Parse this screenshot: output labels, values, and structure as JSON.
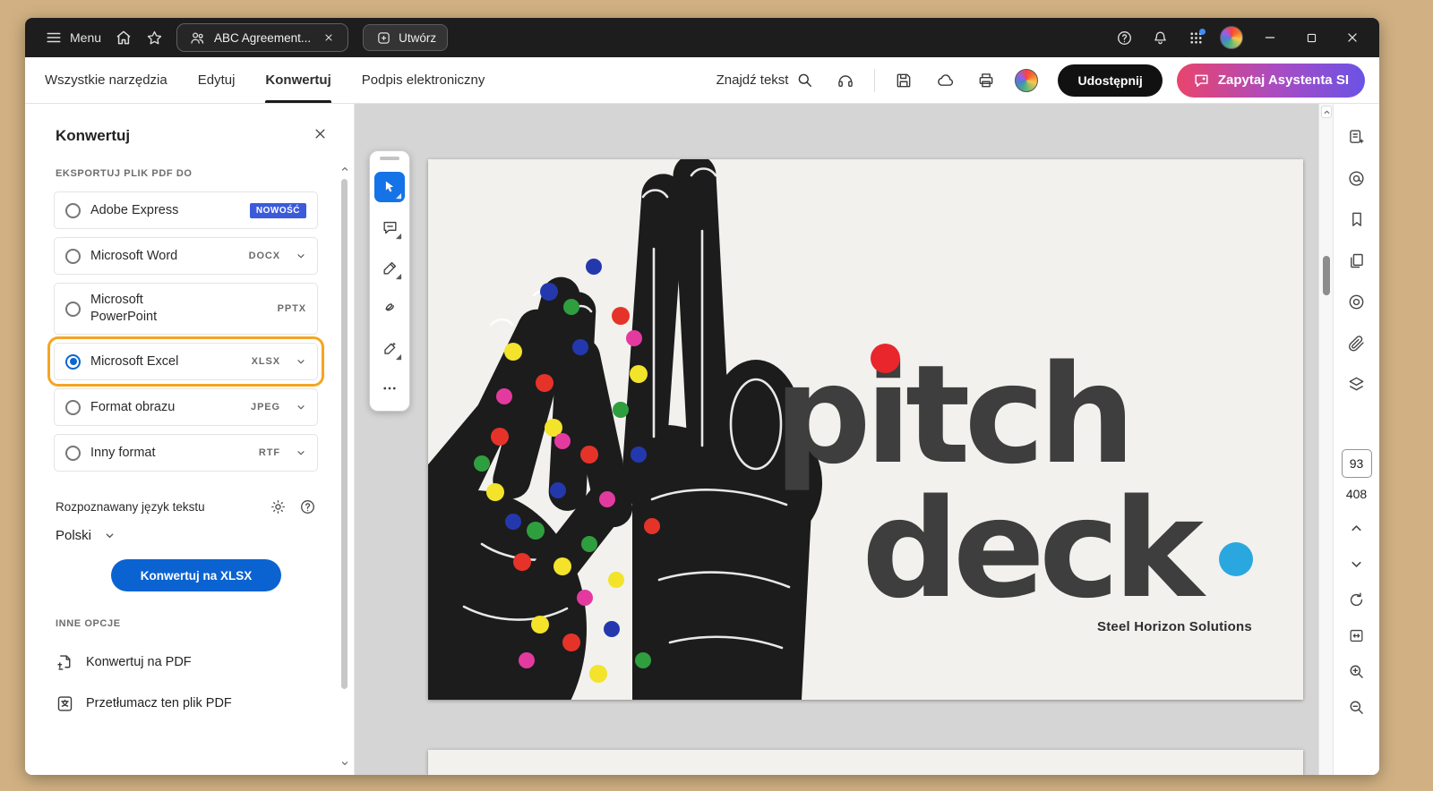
{
  "titlebar": {
    "menu": "Menu",
    "tab_title": "ABC Agreement...",
    "create": "Utwórz"
  },
  "toolbar": {
    "tabs": [
      {
        "label": "Wszystkie narzędzia"
      },
      {
        "label": "Edytuj"
      },
      {
        "label": "Konwertuj"
      },
      {
        "label": "Podpis elektroniczny"
      }
    ],
    "find": "Znajdź tekst",
    "share": "Udostępnij",
    "assistant": "Zapytaj Asystenta SI"
  },
  "panel": {
    "title": "Konwertuj",
    "export_section": "EKSPORTUJ PLIK PDF DO",
    "options": [
      {
        "label": "Adobe Express",
        "badge": "NOWOŚĆ"
      },
      {
        "label": "Microsoft Word",
        "format": "DOCX"
      },
      {
        "label": "Microsoft PowerPoint",
        "format": "PPTX"
      },
      {
        "label": "Microsoft Excel",
        "format": "XLSX"
      },
      {
        "label": "Format obrazu",
        "format": "JPEG"
      },
      {
        "label": "Inny format",
        "format": "RTF"
      }
    ],
    "language_label": "Rozpoznawany język tekstu",
    "language_value": "Polski",
    "convert_button": "Konwertuj na XLSX",
    "other_section": "INNE OPCJE",
    "other_options": [
      {
        "label": "Konwertuj na PDF"
      },
      {
        "label": "Przetłumacz ten plik PDF"
      }
    ]
  },
  "document": {
    "title_line1": "pitch",
    "title_line2": "deck",
    "company": "Steel Horizon Solutions"
  },
  "pager": {
    "current": "93",
    "total": "408"
  },
  "colors": {
    "accent_blue": "#0d66d0",
    "highlight_orange": "#f5a522",
    "badge_blue": "#3b5bdb",
    "assistant_gradient_start": "#e9446d",
    "assistant_gradient_end": "#6a53e6",
    "doc_red": "#e8262b",
    "doc_cyan": "#2aa7df",
    "desktop_background": "#d1b183"
  }
}
